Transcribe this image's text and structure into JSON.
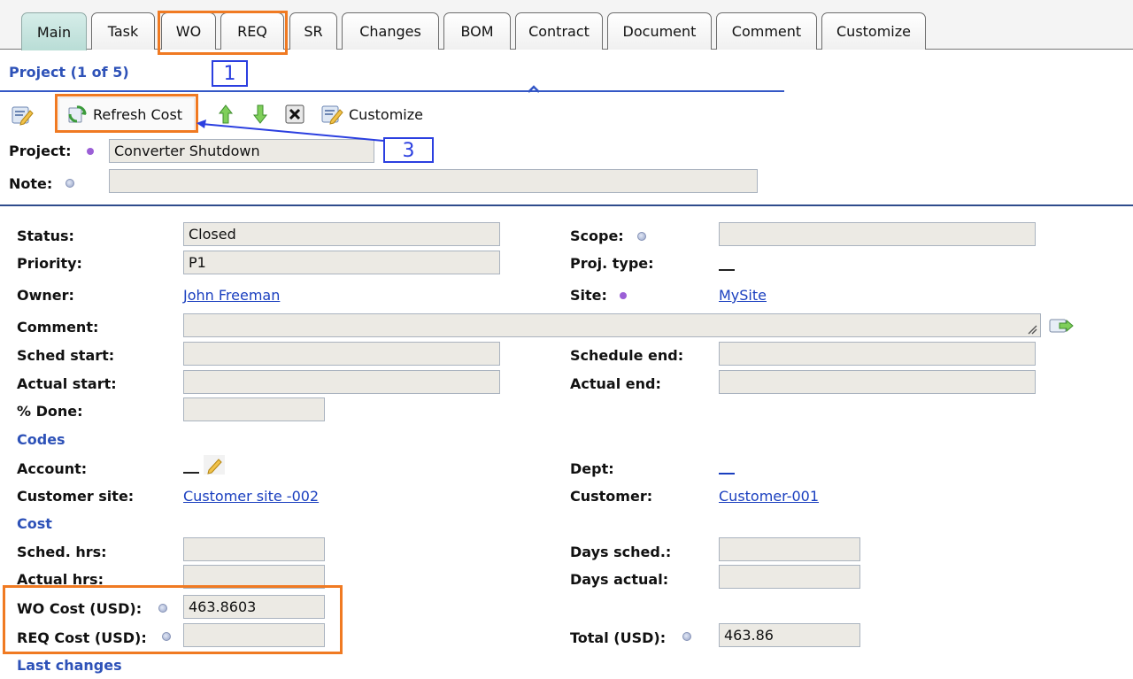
{
  "tabs": [
    "Main",
    "Task",
    "WO",
    "REQ",
    "SR",
    "Changes",
    "BOM",
    "Contract",
    "Document",
    "Comment",
    "Customize"
  ],
  "section_title": "Project (1 of 5)",
  "toolbar": {
    "refresh_label": "Refresh Cost",
    "customize_label": "Customize"
  },
  "header": {
    "project_label": "Project:",
    "project_value": "Converter Shutdown",
    "note_label": "Note:",
    "note_value": ""
  },
  "form": {
    "status_label": "Status:",
    "status_value": "Closed",
    "scope_label": "Scope:",
    "scope_value": "",
    "priority_label": "Priority:",
    "priority_value": "P1",
    "proj_type_label": "Proj. type:",
    "owner_label": "Owner:",
    "owner_value": "John Freeman",
    "site_label": "Site:",
    "site_value": "MySite",
    "comment_label": "Comment:",
    "comment_value": "",
    "sched_start_label": "Sched start:",
    "sched_start_value": "",
    "schedule_end_label": "Schedule end:",
    "schedule_end_value": "",
    "actual_start_label": "Actual start:",
    "actual_start_value": "",
    "actual_end_label": "Actual end:",
    "actual_end_value": "",
    "pct_done_label": "% Done:",
    "pct_done_value": "",
    "codes_heading": "Codes",
    "account_label": "Account:",
    "dept_label": "Dept:",
    "customer_site_label": "Customer site:",
    "customer_site_value": "Customer site -002",
    "customer_label": "Customer:",
    "customer_value": "Customer-001",
    "cost_heading": "Cost",
    "sched_hrs_label": "Sched. hrs:",
    "sched_hrs_value": "",
    "days_sched_label": "Days sched.:",
    "days_sched_value": "",
    "actual_hrs_label": "Actual hrs:",
    "actual_hrs_value": "",
    "days_actual_label": "Days actual:",
    "days_actual_value": "",
    "wo_cost_label": "WO Cost (USD):",
    "wo_cost_value": "463.8603",
    "req_cost_label": "REQ Cost (USD):",
    "req_cost_value": "",
    "total_label": "Total (USD):",
    "total_value": "463.86",
    "last_changes_heading": "Last changes"
  },
  "annotations": {
    "marker_1": "1",
    "marker_3": "3",
    "highlight_color": "#f07a22",
    "marker_color": "#2b3fe0"
  },
  "colors": {
    "active_tab": "#c2e2dc",
    "heading_blue": "#2e52b8",
    "link_blue": "#1a3fbf"
  }
}
